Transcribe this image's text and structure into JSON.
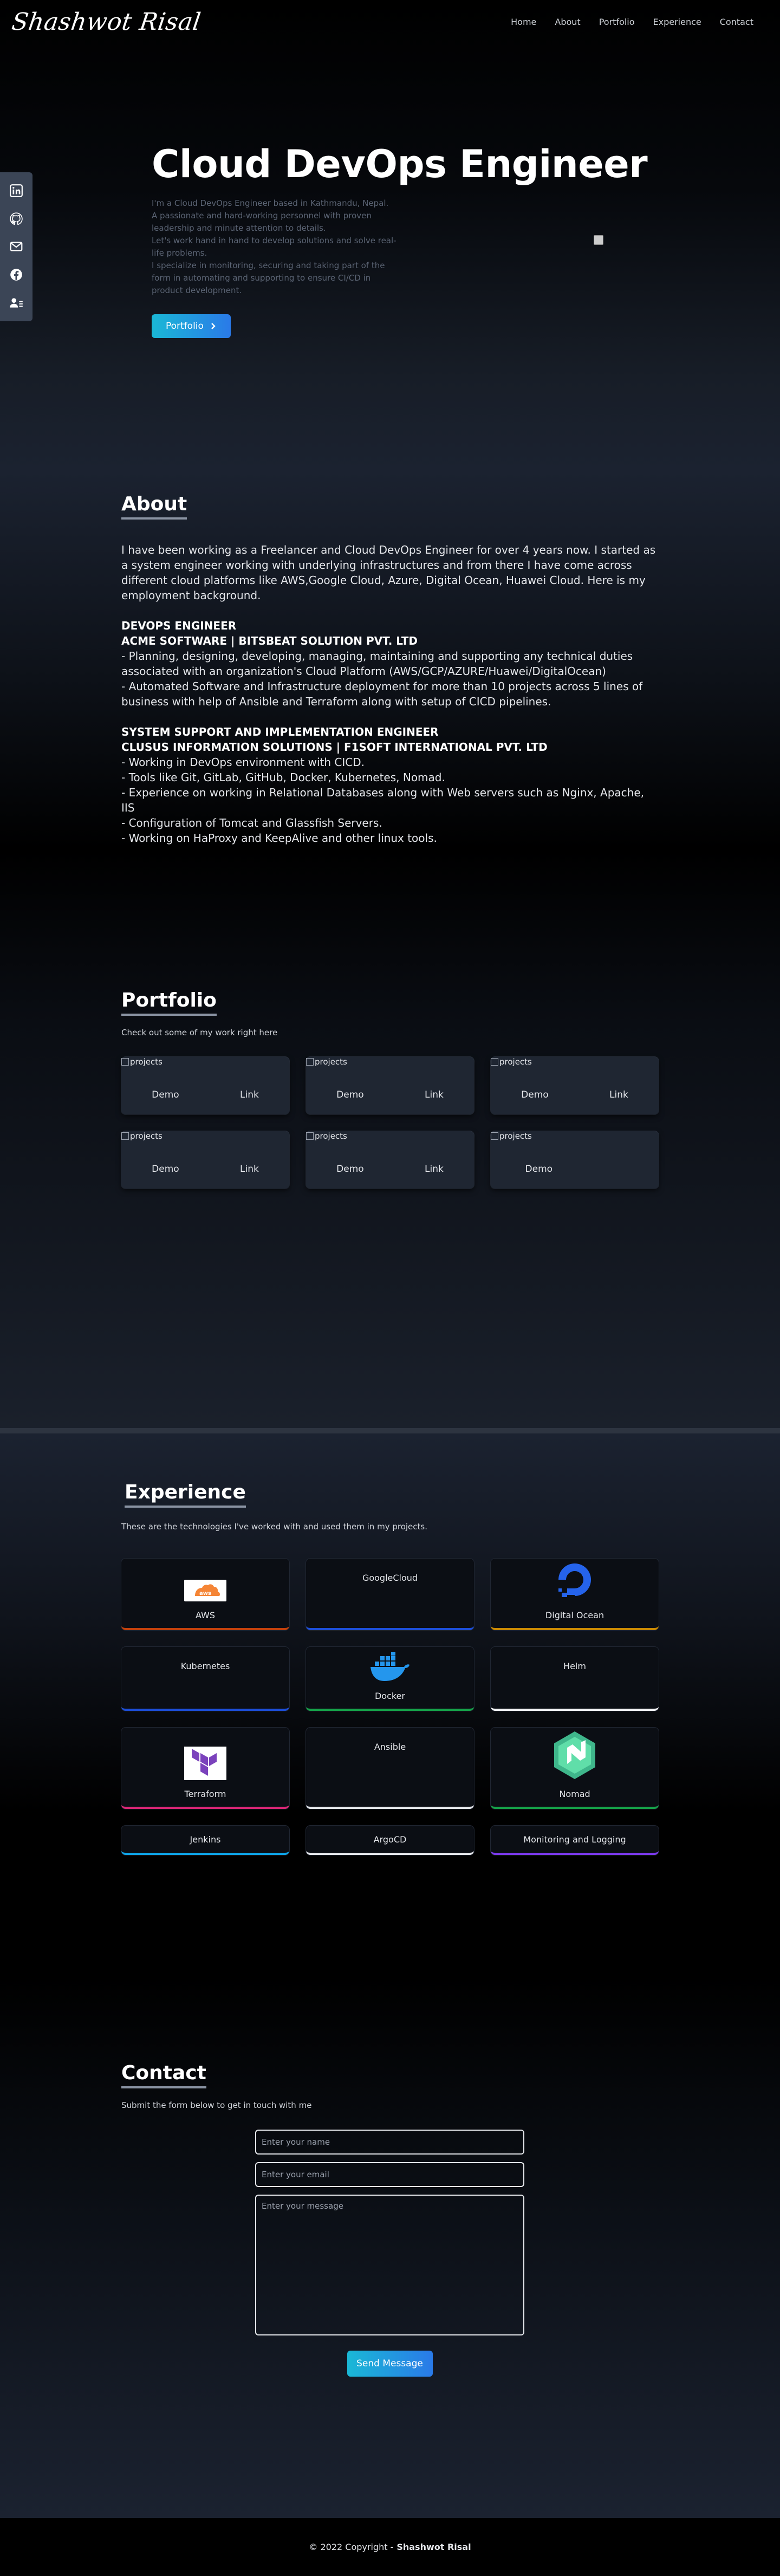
{
  "nav": {
    "logo": "Shashwot Risal",
    "links": [
      "Home",
      "About",
      "Portfolio",
      "Experience",
      "Contact"
    ]
  },
  "social": {
    "items": [
      "linkedin-icon",
      "github-icon",
      "mail-icon",
      "facebook-icon",
      "resume-icon"
    ],
    "bg_color": "#3b4556"
  },
  "hero": {
    "title": "Cloud DevOps Engineer",
    "lines": [
      "I'm a Cloud DevOps Engineer based in Kathmandu, Nepal.",
      "A passionate and hard-working personnel with proven leadership and minute attention to details.",
      "Let's work hand in hand to develop solutions and solve real-life problems.",
      "I specialize in monitoring, securing and taking part of the form in automating and supporting to ensure CI/CD in product development."
    ],
    "button_label": "Portfolio",
    "accent": "#1ab8d6"
  },
  "about": {
    "title": "About",
    "intro": "I have been working as a Freelancer and Cloud DevOps Engineer for over 4 years now. I started as a system engineer working with underlying infrastructures and from there I have come across different cloud platforms like AWS,Google Cloud, Azure, Digital Ocean, Huawei Cloud. Here is my employment background.",
    "jobs": [
      {
        "role": "DEVOPS ENGINEER",
        "company": "ACME SOFTWARE | BITSBEAT SOLUTION PVT. LTD",
        "duties": [
          "- Planning, designing, developing, managing, maintaining and supporting any technical duties associated with an organization's Cloud Platform (AWS/GCP/AZURE/Huawei/DigitalOcean)",
          "- Automated Software and Infrastructure deployment for more than 10 projects across 5 lines of business with help of Ansible and Terraform along with setup of CICD pipelines."
        ]
      },
      {
        "role": "SYSTEM SUPPORT AND IMPLEMENTATION ENGINEER",
        "company": "CLUSUS INFORMATION SOLUTIONS | F1SOFT INTERNATIONAL PVT. LTD",
        "duties": [
          "- Working in DevOps environment with CICD.",
          "- Tools like Git, GitLab, GitHub, Docker, Kubernetes, Nomad.",
          "- Experience on working in Relational Databases along with Web servers such as Nginx, Apache, IIS",
          "- Configuration of Tomcat and Glassfish Servers.",
          "- Working on HaProxy and KeepAlive and other linux tools."
        ]
      }
    ]
  },
  "portfolio": {
    "title": "Portfolio",
    "subtitle": "Check out some of my work right here",
    "card_img_alt": "projects",
    "demo_label": "Demo",
    "link_label": "Link",
    "cards": [
      {
        "has_link": true
      },
      {
        "has_link": true
      },
      {
        "has_link": true
      },
      {
        "has_link": true
      },
      {
        "has_link": true
      },
      {
        "has_link": false
      }
    ]
  },
  "experience": {
    "title": "Experience",
    "subtitle": "These are the technologies I've worked with and used them in my projects.",
    "items": [
      {
        "name": "AWS",
        "color": "#c2410c",
        "logo": "aws-icon"
      },
      {
        "name": "GoogleCloud",
        "color": "#1d4ed8",
        "logo": ""
      },
      {
        "name": "Digital Ocean",
        "color": "#ca8a04",
        "logo": "digital-ocean-icon"
      },
      {
        "name": "Kubernetes",
        "color": "#1d4ed8",
        "logo": ""
      },
      {
        "name": "Docker",
        "color": "#16a34a",
        "logo": "docker-icon"
      },
      {
        "name": "Helm",
        "color": "#f3f4f6",
        "logo": ""
      },
      {
        "name": "Terraform",
        "color": "#db2777",
        "logo": "terraform-icon"
      },
      {
        "name": "Ansible",
        "color": "#e5e7eb",
        "logo": ""
      },
      {
        "name": "Nomad",
        "color": "#16a34a",
        "logo": "nomad-icon"
      },
      {
        "name": "Jenkins",
        "color": "#0ea5e9",
        "logo": ""
      },
      {
        "name": "ArgoCD",
        "color": "#e5e7eb",
        "logo": ""
      },
      {
        "name": "Monitoring and Logging",
        "color": "#7c3aed",
        "logo": ""
      }
    ]
  },
  "contact": {
    "title": "Contact",
    "subtitle": "Submit the form below to get in touch with me",
    "name_placeholder": "Enter your name",
    "email_placeholder": "Enter your email",
    "message_placeholder": "Enter your message",
    "button_label": "Send Message"
  },
  "footer": {
    "copyright": "© 2022 Copyright -",
    "author": "Shashwot Risal"
  }
}
